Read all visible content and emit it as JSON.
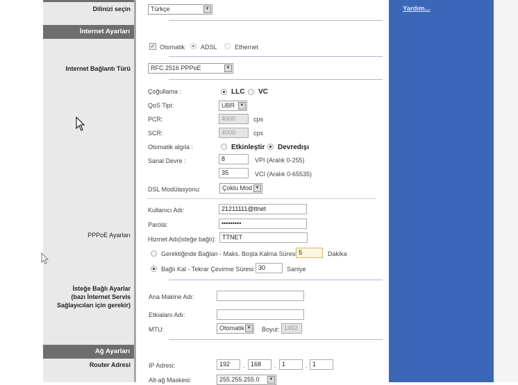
{
  "left": {
    "language_label": "Dilinizi seçin",
    "internet_header": "İnternet Ayarları",
    "conn_type_label": "Internet Bağlantı Türü",
    "pppoe_label": "PPPoE Ayarları",
    "optional_label_1": "İsteğe Bağlı Ayarlar",
    "optional_label_2": "(bazı İnternet Servis",
    "optional_label_3": "Sağlayıcıları için gerekir)",
    "network_header": "Ağ Ayarları",
    "router_label": "Router Adresi"
  },
  "help": {
    "link": "Yardım..."
  },
  "lang": {
    "value": "Türkçe"
  },
  "auto": {
    "checkbox": "Otomatik",
    "checked": true,
    "adsl": "ADSL",
    "ethernet": "Ethernet"
  },
  "conn_type": {
    "value": "RFC 2516 PPPoE"
  },
  "encap": {
    "label": "Çoğullama :",
    "llc": "LLC",
    "vc": "VC",
    "selected": "LLC"
  },
  "qos": {
    "label": "QoS Tipi:",
    "value": "UBR"
  },
  "pcr": {
    "label": "PCR:",
    "value": "4000",
    "unit": "cps"
  },
  "scr": {
    "label": "SCR:",
    "value": "4000",
    "unit": "cps"
  },
  "autodetect": {
    "label": "Otomatik algıla :",
    "enable": "Etkinleştir",
    "disable": "Devredışı",
    "selected": "Devredışı"
  },
  "vc": {
    "label": "Sanal Devre :",
    "vpi": "8",
    "vpi_range": "VPI (Aralık 0-255)",
    "vci": "35",
    "vci_range": "VCI (Aralık 0-65535)"
  },
  "dsl": {
    "label": "DSL Modülasyonu:",
    "value": "Çoklu Mod"
  },
  "pppoe": {
    "user_label": "Kullanıcı Adı:",
    "user": "21211111@ttnet",
    "pass_label": "Parola:",
    "pass": "•••••••••",
    "service_label": "Hizmet Adı(isteğe bağlı):",
    "service": "TTNET",
    "ondemand": "Gerektiğinde Bağlan - Maks. Boşta Kalma Süresi:",
    "ondemand_value": "5",
    "ondemand_unit": "Dakika",
    "keepalive": "Bağlı Kal - Tekrar Çevirme Süresi:",
    "keepalive_value": "30",
    "keepalive_unit": "Saniye"
  },
  "optional": {
    "host_label": "Ana Makine Adı:",
    "host": "",
    "domain_label": "Etkialanı Adı:",
    "domain": "",
    "mtu_label": "MTU:",
    "mtu": "Otomatik",
    "size_label": "Boyut:",
    "size": "1492"
  },
  "network": {
    "ip_label": "IP Adresi:",
    "ip": [
      "192",
      "168",
      "1",
      "1"
    ],
    "mask_label": "Alt-ağ Maskesi:",
    "mask": "255.255.255.0"
  }
}
